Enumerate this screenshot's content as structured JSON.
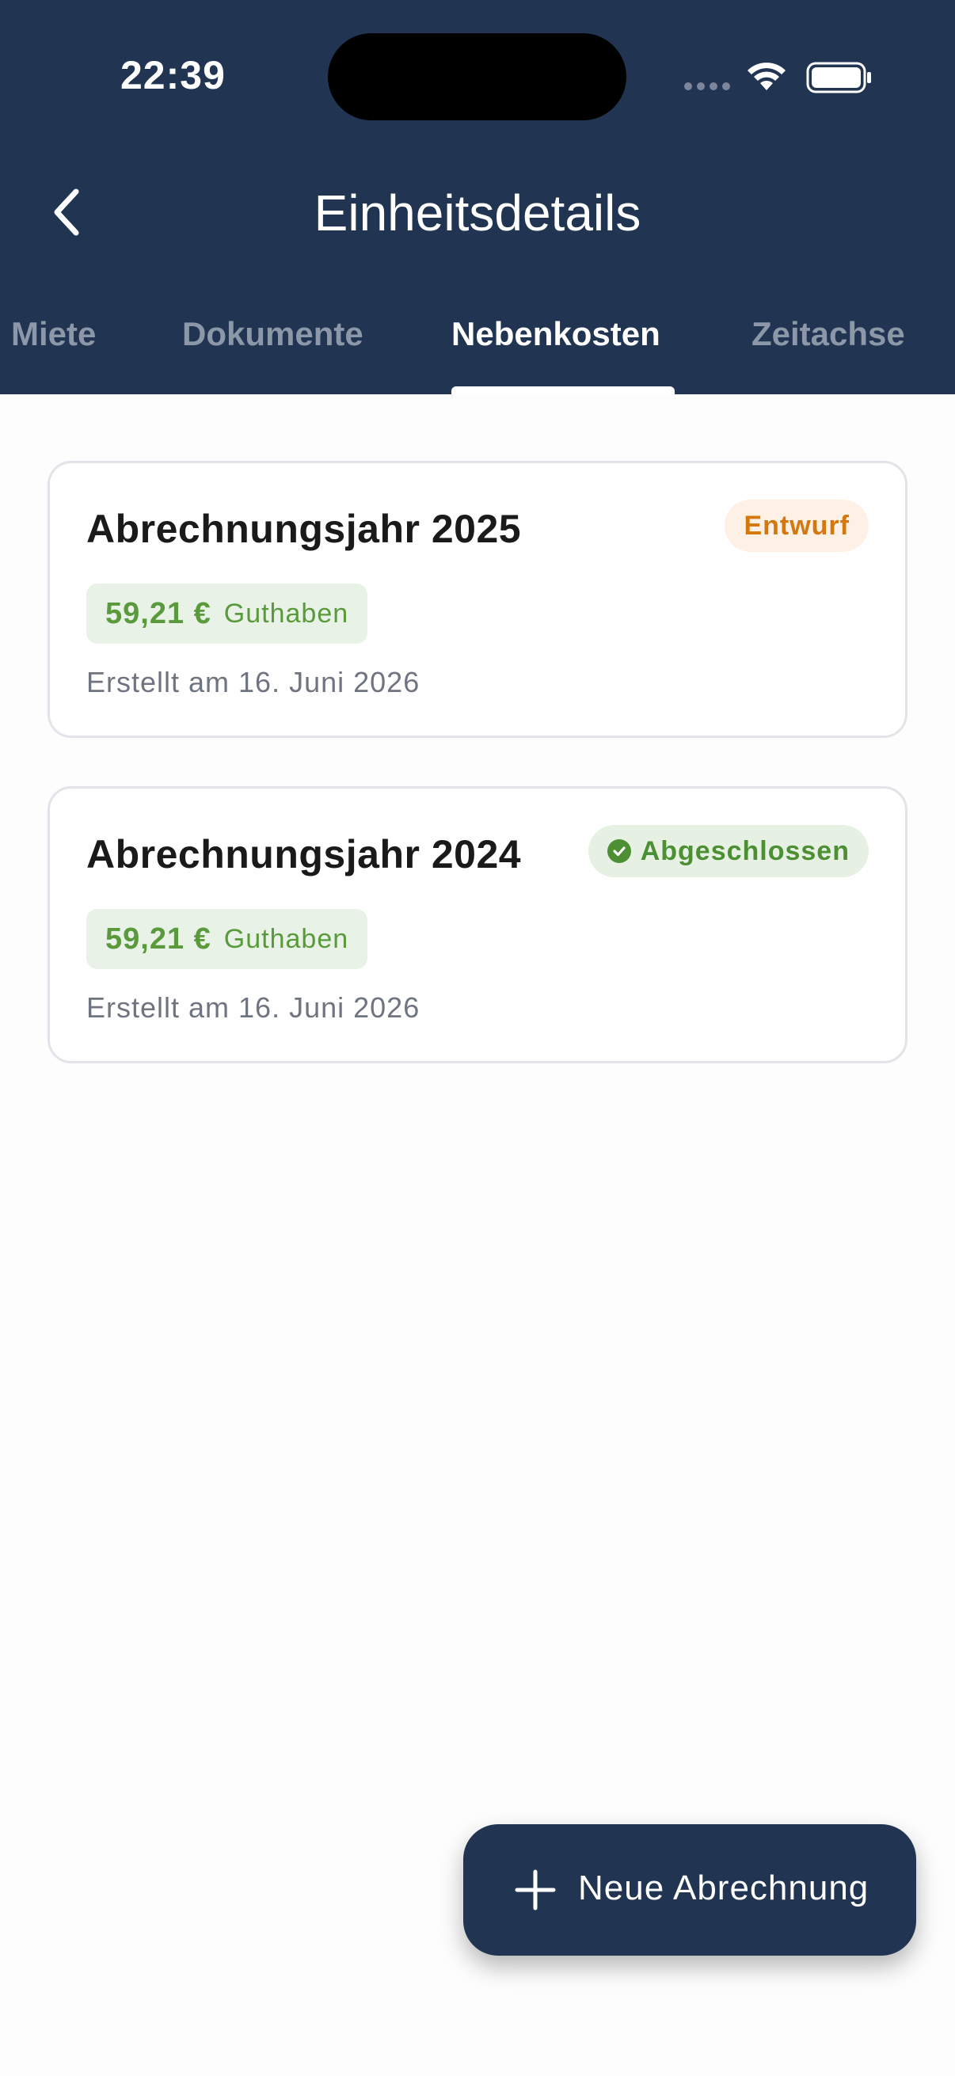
{
  "status_bar": {
    "time": "22:39"
  },
  "header": {
    "title": "Einheitsdetails",
    "back_icon": "chevron-left-icon"
  },
  "tabs": [
    {
      "label": "Miete",
      "active": false
    },
    {
      "label": "Dokumente",
      "active": false
    },
    {
      "label": "Nebenkosten",
      "active": true
    },
    {
      "label": "Zeitachse",
      "active": false
    }
  ],
  "statements": [
    {
      "title": "Abrechnungsjahr 2025",
      "status": "Entwurf",
      "status_color": "#d4780e",
      "amount": "59,21 €",
      "amount_label": "Guthaben",
      "created": "Erstellt am 16. Juni 2026"
    },
    {
      "title": "Abrechnungsjahr 2024",
      "status": "Abgeschlossen",
      "status_color": "#4d8f33",
      "status_icon": "check-circle-icon",
      "amount": "59,21 €",
      "amount_label": "Guthaben",
      "created": "Erstellt am 16. Juni 2026"
    }
  ],
  "fab": {
    "label": "Neue Abrechnung",
    "icon": "plus-icon"
  },
  "colors": {
    "primary": "#213553",
    "positive": "#5a9a3c",
    "draft": "#d4780e"
  }
}
